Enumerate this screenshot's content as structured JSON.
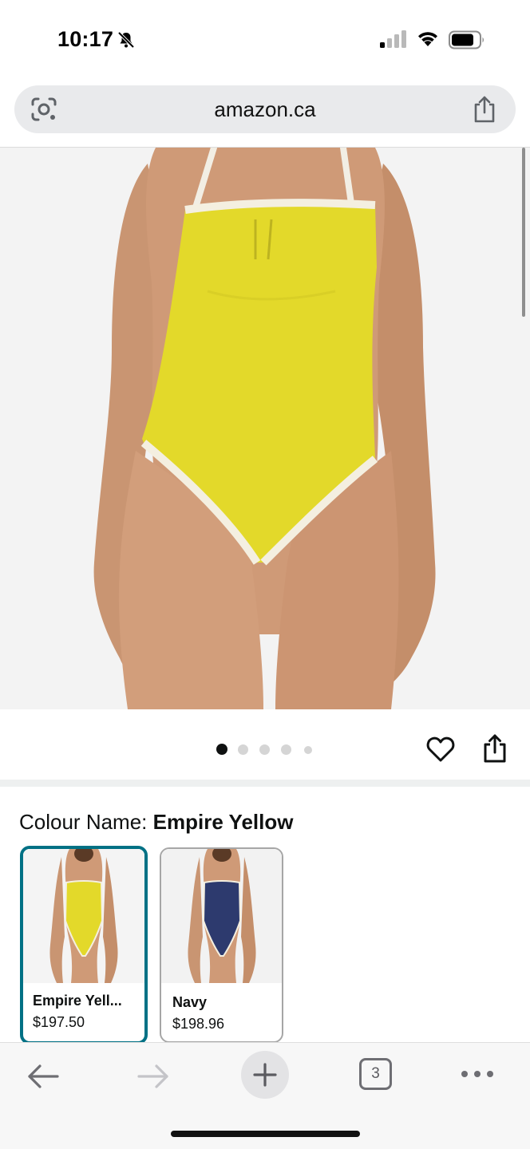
{
  "status_bar": {
    "time": "10:17",
    "icons": [
      "bell-slash-icon",
      "cellular-signal-icon",
      "wifi-icon",
      "battery-icon"
    ]
  },
  "url_bar": {
    "url": "amazon.ca",
    "icons": [
      "lens-icon",
      "share-icon"
    ]
  },
  "product": {
    "image_description_icon": "product-photo",
    "carousel_dot_count": 5,
    "carousel_active_index": 0
  },
  "colour": {
    "label": "Colour Name:",
    "value": "Empire Yellow",
    "options": [
      {
        "name": "Empire Yell...",
        "price": "$197.50",
        "selected": true
      },
      {
        "name": "Navy",
        "price": "$198.96",
        "selected": false
      }
    ]
  },
  "toolbar": {
    "tab_count": "3",
    "icons": [
      "back-arrow-icon",
      "forward-arrow-icon",
      "plus-icon",
      "tabs-icon",
      "more-icon"
    ]
  },
  "colors": {
    "accent_teal": "#007185",
    "swimsuit_yellow": "#e3d92a",
    "swimsuit_navy": "#2d3a6e"
  }
}
